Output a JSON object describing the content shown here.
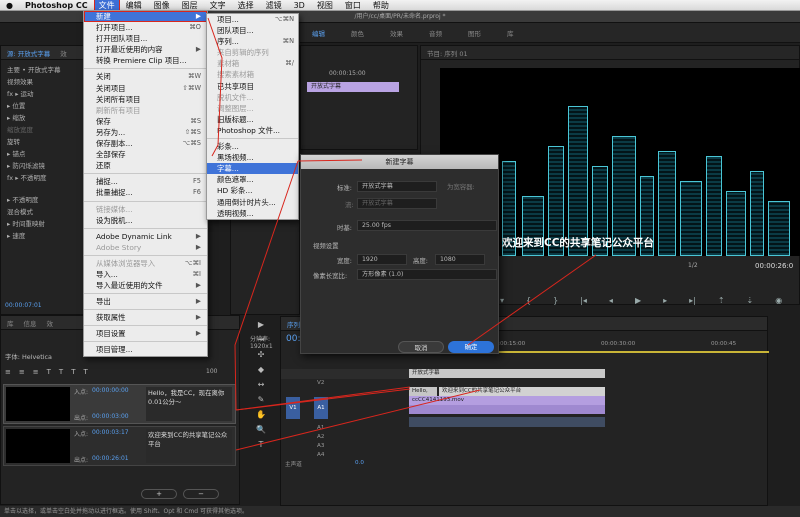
{
  "menubar": {
    "apple": "",
    "app": "Photoshop CC",
    "items": [
      "文件",
      "编辑",
      "图像",
      "图层",
      "文字",
      "选择",
      "滤镜",
      "3D",
      "视图",
      "窗口",
      "帮助"
    ]
  },
  "window_title": "/用户/cc/桌面/PR/未命名.prproj *",
  "source_panel": {
    "tab1": "源: 开放式字幕",
    "tab2": "效",
    "master": "主要 • 开放式字幕",
    "video_effects": "视频效果",
    "rows": [
      "fx ▸ 运动",
      "▸ 位置",
      "▸ 缩放",
      "缩放宽度",
      "旋转",
      "▸ 锚点",
      "▸ 防闪烁滤镜",
      "fx ▸ 不透明度",
      "▸ 不透明度",
      "混合模式",
      "▸ 时间重映射",
      "▸ 速度"
    ],
    "timecode": "00:00:07:01"
  },
  "caption_panel": {
    "tabs": [
      "库",
      "信息",
      "效"
    ],
    "font_label": "字体: Helvetica",
    "size": "100",
    "resolution": "分辨率: 1920x1",
    "items": [
      {
        "in_label": "入点:",
        "in_tc": "00:00:00:00",
        "out_label": "出点:",
        "out_tc": "00:00:03:00",
        "text": "Hello，我是CC，现在离你0.01公分～"
      },
      {
        "in_label": "入点:",
        "in_tc": "00:00:03:17",
        "out_label": "出点:",
        "out_tc": "00:00:26:01",
        "text": "欢迎来到CC的共享笔记公众平台"
      }
    ],
    "add": "+",
    "remove": "−"
  },
  "file_menu": [
    {
      "label": "新建",
      "sc": "▶",
      "state": "highlight"
    },
    {
      "label": "打开项目...",
      "sc": "⌘O"
    },
    {
      "label": "打开团队项目...",
      "sc": ""
    },
    {
      "label": "打开最近使用的内容",
      "sc": "▶"
    },
    {
      "label": "转换 Premiere Clip 项目...",
      "sc": ""
    },
    {
      "sep": true
    },
    {
      "label": "关闭",
      "sc": "⌘W"
    },
    {
      "label": "关闭项目",
      "sc": "⇧⌘W"
    },
    {
      "label": "关闭所有项目",
      "sc": ""
    },
    {
      "label": "刷新所有项目",
      "sc": "",
      "dis": true
    },
    {
      "label": "保存",
      "sc": "⌘S"
    },
    {
      "label": "另存为...",
      "sc": "⇧⌘S"
    },
    {
      "label": "保存副本...",
      "sc": "⌥⌘S"
    },
    {
      "label": "全部保存",
      "sc": ""
    },
    {
      "label": "还原",
      "sc": ""
    },
    {
      "sep": true
    },
    {
      "label": "捕捉...",
      "sc": "F5"
    },
    {
      "label": "批量捕捉...",
      "sc": "F6"
    },
    {
      "sep": true
    },
    {
      "label": "链接媒体...",
      "sc": "",
      "dis": true
    },
    {
      "label": "设为脱机...",
      "sc": ""
    },
    {
      "sep": true
    },
    {
      "label": "Adobe Dynamic Link",
      "sc": "▶"
    },
    {
      "label": "Adobe Story",
      "sc": "▶",
      "dis": true
    },
    {
      "sep": true
    },
    {
      "label": "从媒体浏览器导入",
      "sc": "⌥⌘I",
      "dis": true
    },
    {
      "label": "导入...",
      "sc": "⌘I"
    },
    {
      "label": "导入最近使用的文件",
      "sc": "▶"
    },
    {
      "sep": true
    },
    {
      "label": "导出",
      "sc": "▶"
    },
    {
      "sep": true
    },
    {
      "label": "获取属性",
      "sc": "▶"
    },
    {
      "sep": true
    },
    {
      "label": "项目设置",
      "sc": "▶"
    },
    {
      "sep": true
    },
    {
      "label": "项目管理...",
      "sc": ""
    }
  ],
  "new_submenu": [
    {
      "label": "项目...",
      "sc": "⌥⌘N"
    },
    {
      "label": "团队项目...",
      "sc": ""
    },
    {
      "label": "序列...",
      "sc": "⌘N"
    },
    {
      "label": "来自剪辑的序列",
      "sc": "",
      "dis": true
    },
    {
      "label": "素材箱",
      "sc": "⌘/",
      "dis": true
    },
    {
      "label": "搜索素材箱",
      "sc": "",
      "dis": true
    },
    {
      "label": "已共享项目",
      "sc": ""
    },
    {
      "label": "脱机文件...",
      "sc": "",
      "dis": true
    },
    {
      "label": "调整图层...",
      "sc": "",
      "dis": true
    },
    {
      "label": "旧版标题...",
      "sc": ""
    },
    {
      "label": "Photoshop 文件...",
      "sc": ""
    },
    {
      "sep": true
    },
    {
      "label": "彩条...",
      "sc": ""
    },
    {
      "label": "黑场视频...",
      "sc": ""
    },
    {
      "label": "字幕...",
      "sc": "",
      "state": "selected"
    },
    {
      "label": "颜色遮罩...",
      "sc": ""
    },
    {
      "label": "HD 彩条...",
      "sc": ""
    },
    {
      "label": "通用倒计时片头...",
      "sc": ""
    },
    {
      "label": "透明视频...",
      "sc": ""
    }
  ],
  "top_tabs": {
    "edit": "编辑",
    "items": [
      "颜色",
      "效果",
      "音频",
      "图形",
      "库"
    ]
  },
  "mini_timeline": {
    "tc": "00:00:15:00",
    "clip": "开放式字幕"
  },
  "program": {
    "title": "节目: 序列 01",
    "zoom": "1/2",
    "timecode": "00:00:26:0",
    "caption": "欢迎来到CC的共享笔记公众平台"
  },
  "dialog": {
    "title": "新建字幕",
    "standard_label": "标准:",
    "standard_value": "开放式字幕",
    "dual_checkbox": "为宽容器:",
    "stream_label": "流:",
    "stream_value": "开放式字幕",
    "timebase_label": "时基:",
    "timebase_value": "25.00 fps",
    "video_settings": "视频设置",
    "width_label": "宽度:",
    "width_value": "1920",
    "height_label": "高度:",
    "height_value": "1080",
    "par_label": "像素长宽比:",
    "par_value": "方形像素 (1.0)",
    "cancel": "取消",
    "ok": "确定"
  },
  "timeline": {
    "tab": "序列",
    "tc": "00:",
    "ruler": [
      "00:00:15:00",
      "00:00:30:00",
      "00:00:45"
    ],
    "tracks": [
      "V2",
      "V1",
      "A1",
      "A2",
      "A3",
      "A4"
    ],
    "master": "主声道",
    "master_val": "0.0",
    "caption_track": "开放式字幕",
    "caption_clips": [
      "Hello,",
      "欢迎来到CC的共享笔记公众平台"
    ],
    "video_clip": "ccCC4141193.mov",
    "v1": "V1",
    "a1": "A1"
  },
  "status_bar": "单击以选择，或单击空白处并拖动以进行框选。使用 Shift、Opt 和 Cmd 可获得其他选项。",
  "colors": {
    "accent": "#3f73d8",
    "annotation": "#d8261d",
    "cyan": "#4ac6d6"
  }
}
